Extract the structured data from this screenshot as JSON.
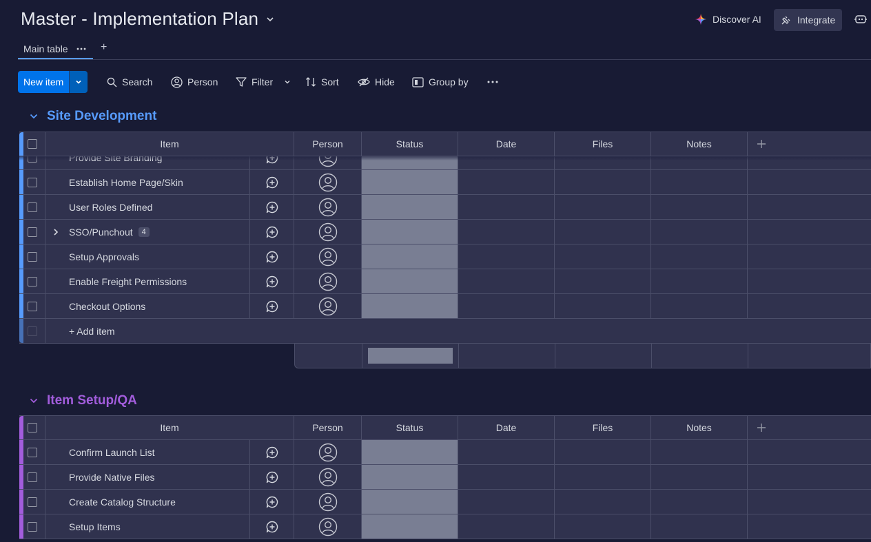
{
  "board": {
    "title": "Master - Implementation Plan",
    "discover_ai": "Discover AI",
    "integrate": "Integrate",
    "tabs": [
      {
        "label": "Main table"
      }
    ],
    "tab_add": "+"
  },
  "toolbar": {
    "new_item": "New item",
    "search": "Search",
    "person": "Person",
    "filter": "Filter",
    "sort": "Sort",
    "hide": "Hide",
    "group_by": "Group by"
  },
  "columns": {
    "item": "Item",
    "person": "Person",
    "status": "Status",
    "date": "Date",
    "files": "Files",
    "notes": "Notes",
    "add": "+"
  },
  "colors": {
    "group1": "#579bfc",
    "group2": "#a25ddc",
    "status_empty": "#797e93"
  },
  "groups": [
    {
      "title": "Site Development",
      "items": [
        {
          "name": "Provide Site Branding"
        },
        {
          "name": "Establish Home Page/Skin"
        },
        {
          "name": "User Roles Defined"
        },
        {
          "name": "SSO/Punchout",
          "subitems": "4"
        },
        {
          "name": "Setup Approvals"
        },
        {
          "name": "Enable Freight Permissions"
        },
        {
          "name": "Checkout Options"
        }
      ],
      "add_item": "+ Add item"
    },
    {
      "title": "Item Setup/QA",
      "items": [
        {
          "name": "Confirm Launch List"
        },
        {
          "name": "Provide Native Files"
        },
        {
          "name": "Create Catalog Structure"
        },
        {
          "name": "Setup Items"
        }
      ]
    }
  ]
}
